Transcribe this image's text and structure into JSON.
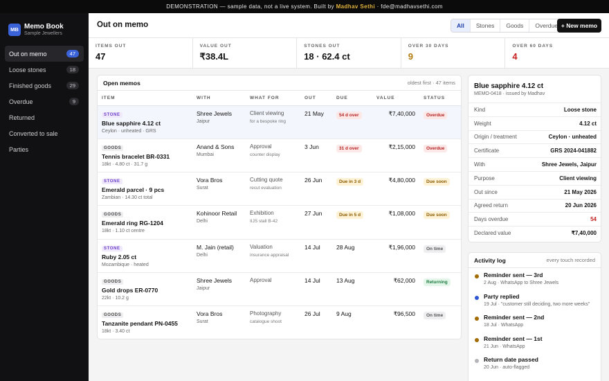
{
  "banner": {
    "prefix": "DEMONSTRATION — sample data, not a live system. Built by",
    "author": "Madhav Sethi",
    "contact": "· fde@madhavsethi.com"
  },
  "sidebar": {
    "logo": "MB",
    "app_name": "Memo Book",
    "org": "Sample Jewellers",
    "items": [
      {
        "label": "Out on memo",
        "count": "47",
        "active": true
      },
      {
        "label": "Loose stones",
        "count": "18"
      },
      {
        "label": "Finished goods",
        "count": "29"
      },
      {
        "label": "Overdue",
        "count": "9"
      },
      {
        "label": "Returned",
        "count": ""
      },
      {
        "label": "Converted to sale",
        "count": ""
      },
      {
        "label": "Parties",
        "count": ""
      }
    ]
  },
  "header": {
    "title": "Out on memo",
    "filters": [
      "All",
      "Stones",
      "Goods",
      "Overdue"
    ],
    "active_filter": "All",
    "new_memo_label": "+ New memo"
  },
  "stats": [
    {
      "label": "ITEMS OUT",
      "value": "47"
    },
    {
      "label": "VALUE OUT",
      "value": "₹38.4L"
    },
    {
      "label": "STONES OUT",
      "value": "18 · 62.4 ct"
    },
    {
      "label": "OVER 30 DAYS",
      "value": "9",
      "color": "#b07b0c"
    },
    {
      "label": "OVER 60 DAYS",
      "value": "4",
      "color": "#c42020"
    }
  ],
  "memos": {
    "title": "Open memos",
    "meta": "oldest first · 47 items",
    "columns": [
      "ITEM",
      "WITH",
      "WHAT FOR",
      "OUT",
      "DUE",
      "VALUE",
      "STATUS"
    ],
    "rows": [
      {
        "tag": "STONE",
        "name": "Blue sapphire 4.12 ct",
        "sub": "Ceylon · unheated · GRS",
        "with": "Shree Jewels",
        "city": "Jaipur",
        "for": "Client viewing",
        "for_sub": "for a bespoke ring",
        "out": "21 May",
        "due": "54 d over",
        "value": "₹7,40,000",
        "status": "Overdue"
      },
      {
        "tag": "GOODS",
        "name": "Tennis bracelet BR-0331",
        "sub": "18kt · 4.80 ct · 31.7 g",
        "with": "Anand & Sons",
        "city": "Mumbai",
        "for": "Approval",
        "for_sub": "counter display",
        "out": "3 Jun",
        "due": "31 d over",
        "value": "₹2,15,000",
        "status": "Overdue"
      },
      {
        "tag": "STONE",
        "name": "Emerald parcel · 9 pcs",
        "sub": "Zambian · 14.30 ct total",
        "with": "Vora Bros",
        "city": "Surat",
        "for": "Cutting quote",
        "for_sub": "recut evaluation",
        "out": "26 Jun",
        "due": "Due in 3 d",
        "value": "₹4,80,000",
        "status": "Due soon"
      },
      {
        "tag": "GOODS",
        "name": "Emerald ring RG-1204",
        "sub": "18kt · 1.10 ct centre",
        "with": "Kohinoor Retail",
        "city": "Delhi",
        "for": "Exhibition",
        "for_sub": "IIJS stall B-42",
        "out": "27 Jun",
        "due": "Due in 5 d",
        "value": "₹1,08,000",
        "status": "Due soon"
      },
      {
        "tag": "STONE",
        "name": "Ruby 2.05 ct",
        "sub": "Mozambique · heated",
        "with": "M. Jain (retail)",
        "city": "Delhi",
        "for": "Valuation",
        "for_sub": "insurance appraisal",
        "out": "14 Jul",
        "due": "28 Aug",
        "value": "₹1,96,000",
        "status": "On time"
      },
      {
        "tag": "GOODS",
        "name": "Gold drops ER-0770",
        "sub": "22kt · 10.2 g",
        "with": "Shree Jewels",
        "city": "Jaipur",
        "for": "Approval",
        "for_sub": "",
        "out": "14 Jul",
        "due": "13 Aug",
        "value": "₹62,000",
        "status": "Returning"
      },
      {
        "tag": "GOODS",
        "name": "Tanzanite pendant PN-0455",
        "sub": "18kt · 3.40 ct",
        "with": "Vora Bros",
        "city": "Surat",
        "for": "Photography",
        "for_sub": "catalogue shoot",
        "out": "26 Jul",
        "due": "9 Aug",
        "value": "₹96,500",
        "status": "On time"
      }
    ]
  },
  "detail": {
    "title": "Blue sapphire 4.12 ct",
    "sub": "MEMO-0418 · issued by Madhav",
    "rows": [
      {
        "label": "Kind",
        "value": "Loose stone"
      },
      {
        "label": "Weight",
        "value": "4.12 ct"
      },
      {
        "label": "Origin / treatment",
        "value": "Ceylon · unheated"
      },
      {
        "label": "Certificate",
        "value": "GRS 2024-041882"
      },
      {
        "label": "With",
        "value": "Shree Jewels, Jaipur"
      },
      {
        "label": "Purpose",
        "value": "Client viewing"
      },
      {
        "label": "Out since",
        "value": "21 May 2026"
      },
      {
        "label": "Agreed return",
        "value": "20 Jun 2026"
      },
      {
        "label": "Days overdue",
        "value": "54"
      },
      {
        "label": "Declared value",
        "value": "₹7,40,000"
      }
    ]
  },
  "activity": {
    "title": "Activity log",
    "meta": "every touch recorded",
    "items": [
      {
        "title": "Reminder sent — 3rd",
        "sub": "2 Aug · WhatsApp to Shree Jewels",
        "dot": "amber"
      },
      {
        "title": "Party replied",
        "sub": "19 Jul · \"customer still deciding, two more weeks\"",
        "dot": "blue"
      },
      {
        "title": "Reminder sent — 2nd",
        "sub": "18 Jul · WhatsApp",
        "dot": "amber"
      },
      {
        "title": "Reminder sent — 1st",
        "sub": "21 Jun · WhatsApp",
        "dot": "amber"
      },
      {
        "title": "Return date passed",
        "sub": "20 Jun · auto-flagged",
        "dot": "gray"
      }
    ]
  }
}
